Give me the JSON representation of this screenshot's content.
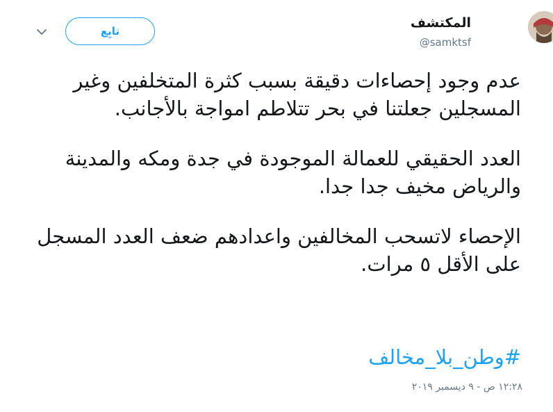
{
  "user": {
    "display_name": "المكتشف",
    "handle": "@samktsf"
  },
  "follow_button": {
    "label": "تابِع"
  },
  "tweet": {
    "paragraphs": [
      "عدم وجود إحصاءات دقيقة بسبب كثرة المتخلفين وغير المسجلين جعلتنا في بحر تتلاطم امواجة بالأجانب.",
      "العدد الحقيقي للعمالة الموجودة في جدة ومكه والمدينة والرياض مخيف جدا جدا.",
      "الإحصاء لاتسحب المخالفين واعدادهم ضعف العدد المسجل على الأقل ٥ مرات."
    ],
    "hashtag": "#وطن_بلا_مخالف",
    "timestamp": "١٢:٢٨ ص - ٩ ديسمبر ٢٠١٩"
  },
  "colors": {
    "accent": "#1da1f2",
    "text": "#14171a",
    "secondary": "#657786"
  },
  "icons": {
    "avatar": "user-avatar",
    "caret": "chevron-down-icon"
  }
}
